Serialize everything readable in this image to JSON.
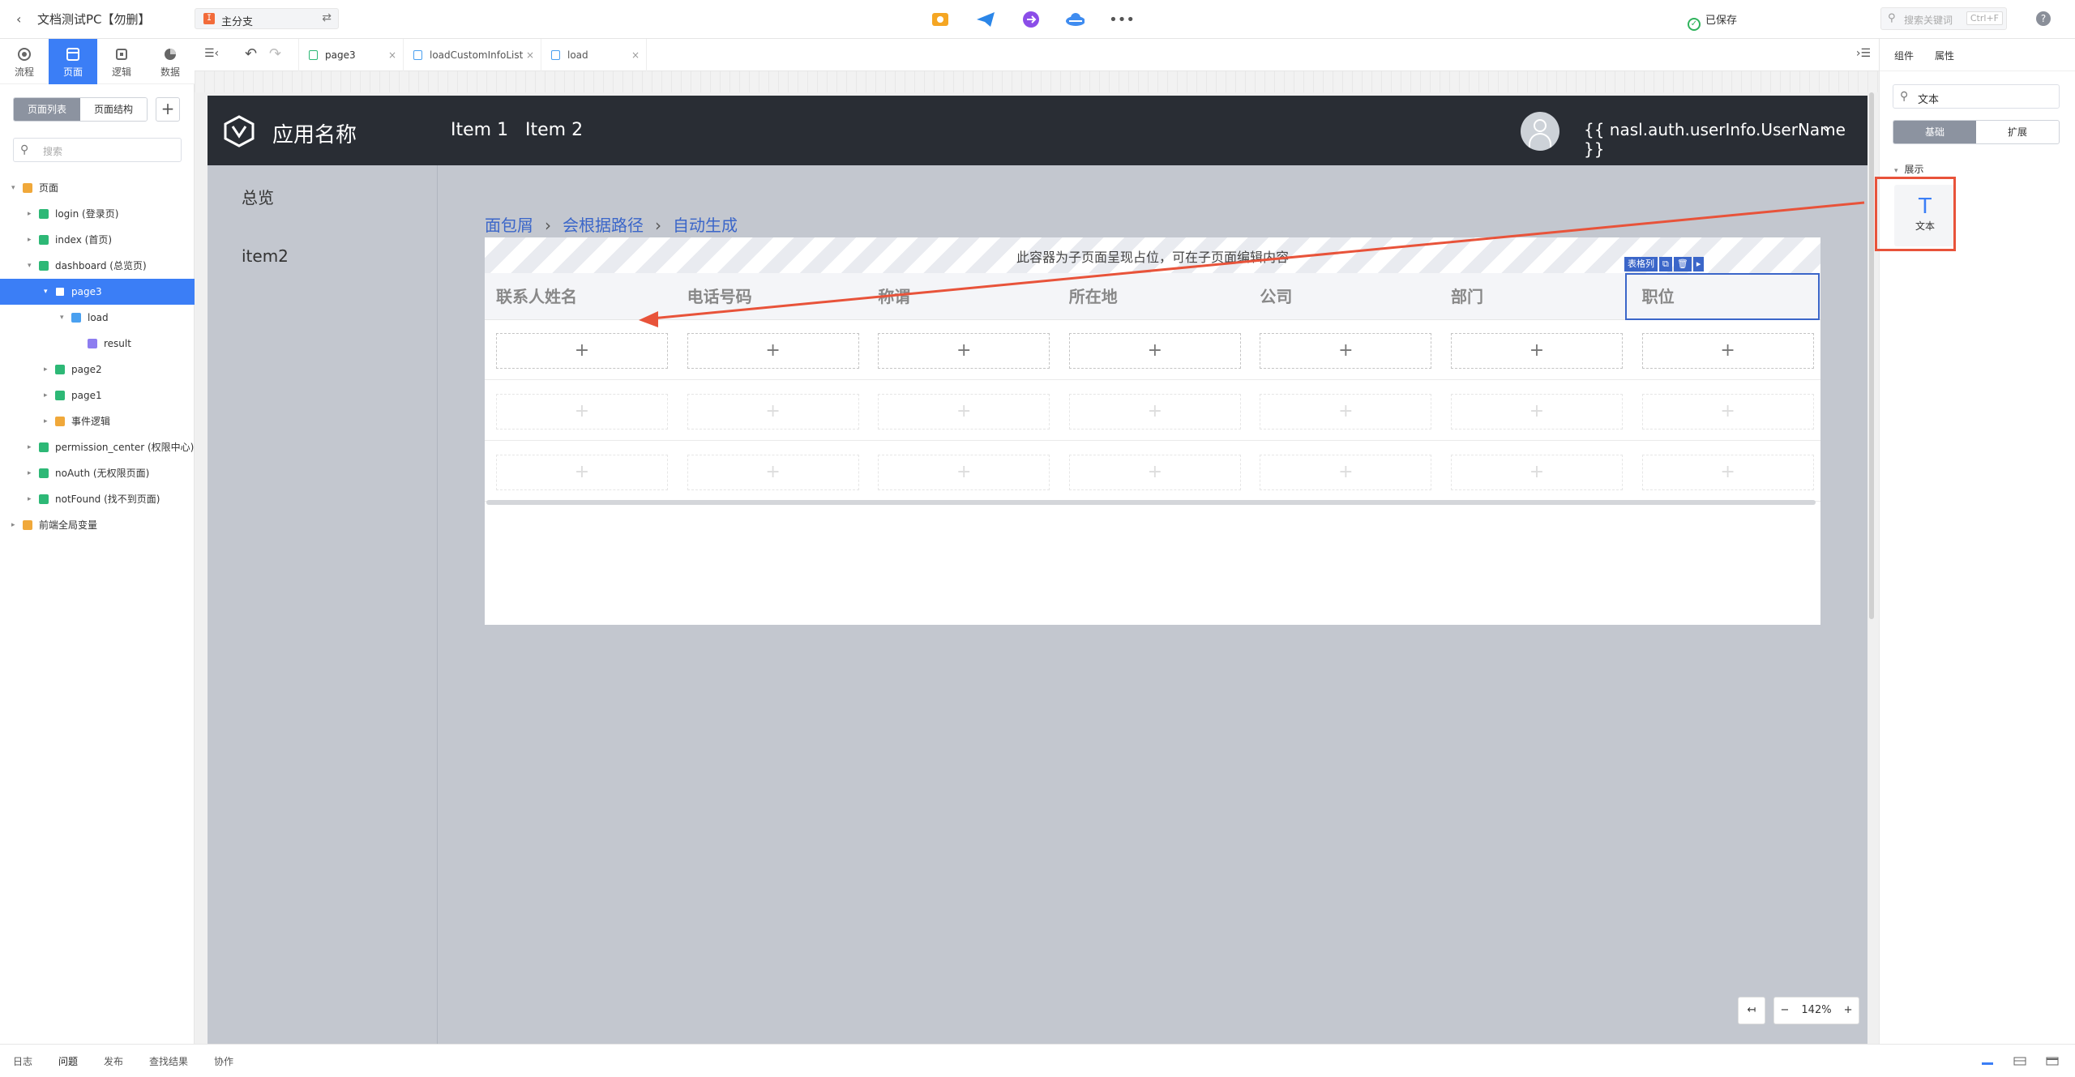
{
  "topbar": {
    "project_title": "文档测试PC【勿删】",
    "branch_label": "主分支",
    "saved_label": "已保存",
    "search_placeholder": "搜索关键词",
    "search_shortcut": "Ctrl+F",
    "help_label": "?"
  },
  "left_rail": {
    "tabs": [
      {
        "label": "流程",
        "icon": "flow-icon"
      },
      {
        "label": "页面",
        "icon": "page-icon",
        "active": true
      },
      {
        "label": "逻辑",
        "icon": "logic-icon"
      },
      {
        "label": "数据",
        "icon": "data-icon"
      }
    ]
  },
  "left_panel": {
    "seg_page_list": "页面列表",
    "seg_page_structure": "页面结构",
    "add_label": "+",
    "search_placeholder": "搜索",
    "tree": [
      {
        "label": "页面",
        "level": 0,
        "type": "folder",
        "arrow": "▾"
      },
      {
        "label": "login (登录页)",
        "level": 1,
        "type": "page",
        "arrow": "▸"
      },
      {
        "label": "index (首页)",
        "level": 1,
        "type": "page",
        "arrow": "▸"
      },
      {
        "label": "dashboard (总览页)",
        "level": 1,
        "type": "page",
        "arrow": "▾"
      },
      {
        "label": "page3",
        "level": 2,
        "type": "page",
        "arrow": "▾",
        "selected": true
      },
      {
        "label": "load",
        "level": 3,
        "type": "logic",
        "arrow": "▾"
      },
      {
        "label": "result",
        "level": 4,
        "type": "var",
        "arrow": ""
      },
      {
        "label": "page2",
        "level": 2,
        "type": "page",
        "arrow": "▸"
      },
      {
        "label": "page1",
        "level": 2,
        "type": "page",
        "arrow": "▸"
      },
      {
        "label": "事件逻辑",
        "level": 2,
        "type": "folder",
        "arrow": "▸"
      },
      {
        "label": "permission_center (权限中心)",
        "level": 1,
        "type": "page",
        "arrow": "▸"
      },
      {
        "label": "noAuth (无权限页面)",
        "level": 1,
        "type": "page",
        "arrow": "▸"
      },
      {
        "label": "notFound (找不到页面)",
        "level": 1,
        "type": "page",
        "arrow": "▸"
      },
      {
        "label": "前端全局变量",
        "level": 0,
        "type": "folder",
        "arrow": "▸"
      }
    ]
  },
  "editor_tabs": [
    {
      "label": "page3",
      "type": "page"
    },
    {
      "label": "loadCustomInfoList",
      "type": "logic"
    },
    {
      "label": "load",
      "type": "logic"
    }
  ],
  "app_preview": {
    "app_name": "应用名称",
    "nav_items": [
      "Item 1",
      "Item 2"
    ],
    "user_name": "{{ nasl.auth.userInfo.UserName }}",
    "sidebar": [
      "总览",
      "item2"
    ],
    "breadcrumb": [
      "面包屑",
      "会根据路径",
      "自动生成"
    ],
    "placeholder_text": "此容器为子页面呈现占位，可在子页面编辑内容",
    "column_tag": "表格列",
    "columns": [
      "联系人姓名",
      "电话号码",
      "称谓",
      "所在地",
      "公司",
      "部门",
      "职位"
    ],
    "add_symbol": "+"
  },
  "zoom": {
    "collapse": "↤",
    "minus": "−",
    "value": "142%",
    "plus": "+"
  },
  "right_panel": {
    "tabs": [
      "组件",
      "属性"
    ],
    "search_value": "文本",
    "seg_basic": "基础",
    "seg_extend": "扩展",
    "section": "展示",
    "component_label": "文本",
    "component_icon": "text-T-icon"
  },
  "bottom_bar": {
    "tabs": [
      "日志",
      "问题",
      "发布",
      "查找结果",
      "协作"
    ]
  },
  "colors": {
    "accent": "#3b7ef6",
    "app_header": "#292d34",
    "canvas": "#c3c7cf",
    "highlight": "#e8533a",
    "breadcrumb": "#3b66c9"
  }
}
